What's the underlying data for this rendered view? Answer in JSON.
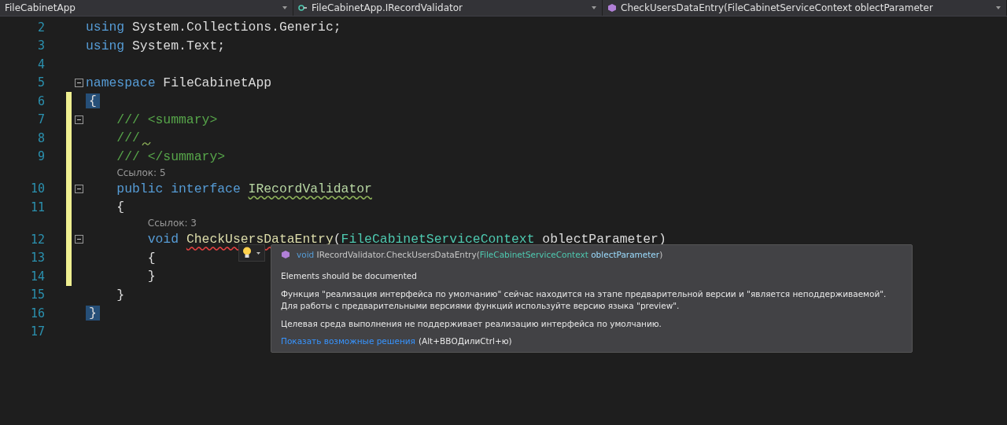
{
  "navigation_bar": [
    {
      "label": "FileCabinetApp",
      "kind": "project"
    },
    {
      "label": "FileCabinetApp.IRecordValidator",
      "kind": "interface"
    },
    {
      "label": "CheckUsersDataEntry(FileCabinetServiceContext oblectParameter",
      "kind": "method"
    }
  ],
  "code_lines": [
    {
      "number": "2",
      "changed": false,
      "fold": false,
      "tokens": [
        {
          "text": "using",
          "kind": "keyword"
        },
        {
          "text": " System.Collections.Generic;",
          "kind": "plain"
        }
      ]
    },
    {
      "number": "3",
      "changed": false,
      "fold": false,
      "tokens": [
        {
          "text": "using",
          "kind": "keyword"
        },
        {
          "text": " System.Text;",
          "kind": "plain"
        }
      ]
    },
    {
      "number": "4",
      "changed": false,
      "fold": false
    },
    {
      "number": "5",
      "changed": false,
      "fold": true,
      "tokens": [
        {
          "text": "namespace",
          "kind": "keyword"
        },
        {
          "text": " FileCabinetApp",
          "kind": "plain"
        }
      ]
    },
    {
      "number": "6",
      "changed": true,
      "fold": false,
      "tokens": [
        {
          "text": "{",
          "kind": "brace-match"
        }
      ]
    },
    {
      "number": "7",
      "changed": true,
      "fold": true,
      "tokens": [
        {
          "text": "    /// <summary>",
          "kind": "comment"
        }
      ]
    },
    {
      "number": "8",
      "changed": true,
      "fold": false,
      "tokens": [
        {
          "text": "    ///",
          "kind": "comment",
          "warning_squiggle_after": true
        }
      ]
    },
    {
      "number": "9",
      "changed": true,
      "fold": false,
      "tokens": [
        {
          "text": "    /// </summary>",
          "kind": "comment"
        }
      ]
    },
    {
      "number": "10",
      "changed": true,
      "fold": true,
      "codelens": "Ссылок: 5",
      "tokens": [
        {
          "text": "    public interface ",
          "kind": "keyword"
        },
        {
          "text": "IRecordValidator",
          "kind": "interface",
          "warning_squiggle": true
        }
      ]
    },
    {
      "number": "11",
      "changed": true,
      "fold": false,
      "tokens": [
        {
          "text": "    {",
          "kind": "plain"
        }
      ]
    },
    {
      "number": "12",
      "changed": true,
      "fold": true,
      "codelens": "Ссылок: 3",
      "tokens": [
        {
          "text": "        void ",
          "kind": "keyword"
        },
        {
          "text": "CheckUsersDataEntry",
          "kind": "method",
          "error_squiggle": true
        },
        {
          "text": "(",
          "kind": "plain"
        },
        {
          "text": "FileCabinetServiceContext",
          "kind": "class"
        },
        {
          "text": " oblectParameter)",
          "kind": "plain"
        }
      ]
    },
    {
      "number": "13",
      "changed": true,
      "fold": false,
      "tokens": [
        {
          "text": "        {",
          "kind": "plain"
        }
      ]
    },
    {
      "number": "14",
      "changed": true,
      "fold": false,
      "tokens": [
        {
          "text": "        }",
          "kind": "plain"
        }
      ]
    },
    {
      "number": "15",
      "changed": false,
      "fold": false,
      "tokens": [
        {
          "text": "    }",
          "kind": "plain"
        }
      ]
    },
    {
      "number": "16",
      "changed": false,
      "fold": false,
      "tokens": [
        {
          "text": "}",
          "kind": "brace-match"
        }
      ]
    },
    {
      "number": "17",
      "changed": false,
      "fold": false
    }
  ],
  "quick_info": {
    "signature": [
      {
        "text": "void",
        "kind": "keyword"
      },
      {
        "text": " IRecordValidator.CheckUsersDataEntry(",
        "kind": "plain"
      },
      {
        "text": "FileCabinetServiceContext",
        "kind": "class"
      },
      {
        "text": " oblectParameter",
        "kind": "param"
      },
      {
        "text": ")",
        "kind": "plain"
      }
    ],
    "messages": [
      "Elements should be documented",
      "Функция \"реализация интерфейса по умолчанию\" сейчас находится на этапе предварительной версии и \"является неподдерживаемой\". Для работы с предварительными версиями функций используйте версию языка \"preview\".",
      "Целевая среда выполнения не поддерживает реализацию интерфейса по умолчанию."
    ],
    "link": "Показать возможные решения",
    "shortcut": "(Alt+ВВОДилиCtrl+ю)"
  }
}
